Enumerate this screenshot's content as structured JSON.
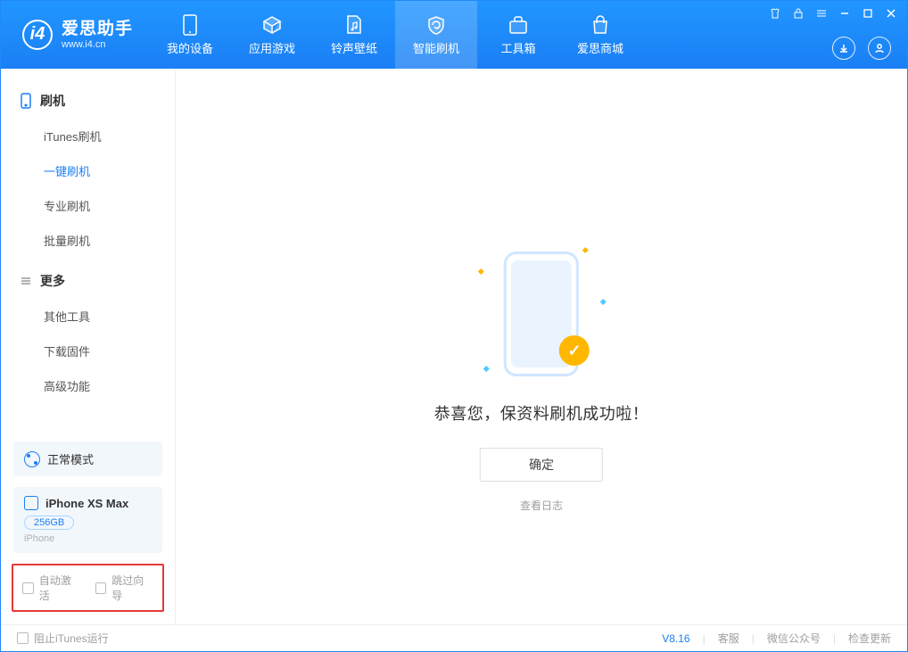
{
  "logo": {
    "title": "爱思助手",
    "subtitle": "www.i4.cn"
  },
  "tabs": [
    {
      "id": "device",
      "label": "我的设备"
    },
    {
      "id": "apps",
      "label": "应用游戏"
    },
    {
      "id": "rings",
      "label": "铃声壁纸"
    },
    {
      "id": "flash",
      "label": "智能刷机"
    },
    {
      "id": "tools",
      "label": "工具箱"
    },
    {
      "id": "store",
      "label": "爱思商城"
    }
  ],
  "sidebar": {
    "section1": {
      "title": "刷机",
      "items": [
        {
          "id": "itunes",
          "label": "iTunes刷机"
        },
        {
          "id": "onekey",
          "label": "一键刷机"
        },
        {
          "id": "pro",
          "label": "专业刷机"
        },
        {
          "id": "batch",
          "label": "批量刷机"
        }
      ]
    },
    "section2": {
      "title": "更多",
      "items": [
        {
          "id": "other",
          "label": "其他工具"
        },
        {
          "id": "fw",
          "label": "下载固件"
        },
        {
          "id": "adv",
          "label": "高级功能"
        }
      ]
    }
  },
  "mode": {
    "label": "正常模式"
  },
  "device": {
    "name": "iPhone XS Max",
    "storage": "256GB",
    "os": "iPhone"
  },
  "options": {
    "auto_activate": "自动激活",
    "skip_guide": "跳过向导"
  },
  "main": {
    "success_msg": "恭喜您，保资料刷机成功啦！",
    "confirm": "确定",
    "view_log": "查看日志"
  },
  "footer": {
    "block_itunes": "阻止iTunes运行",
    "version": "V8.16",
    "links": [
      "客服",
      "微信公众号",
      "检查更新"
    ]
  }
}
